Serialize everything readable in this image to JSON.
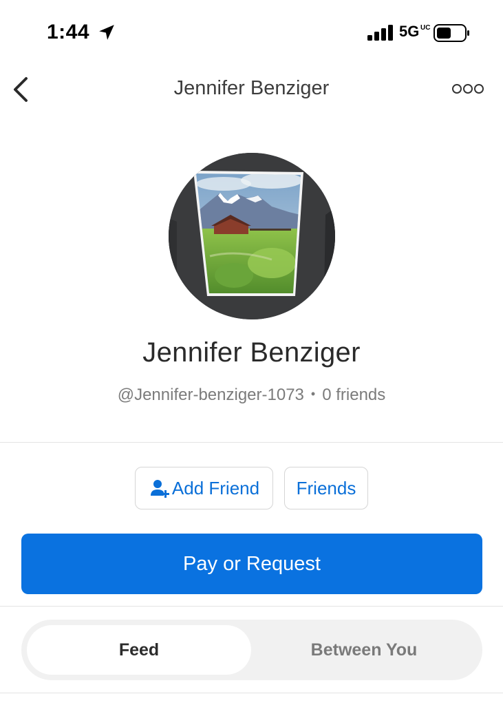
{
  "status_bar": {
    "time": "1:44",
    "network": "5G",
    "network_sub": "UC",
    "icons": [
      "location-arrow-icon",
      "cellular-signal-icon",
      "battery-icon"
    ]
  },
  "nav": {
    "title": "Jennifer Benziger",
    "icons": [
      "back-chevron-icon",
      "more-options-icon"
    ]
  },
  "profile": {
    "name": "Jennifer Benziger",
    "handle": "@Jennifer-benziger-1073",
    "separator": "•",
    "friends_count": "0 friends"
  },
  "actions": {
    "add_friend_label": "Add Friend",
    "add_friend_icon": "add-person-icon",
    "friends_label": "Friends",
    "pay_request_label": "Pay or Request"
  },
  "tabs": {
    "items": [
      {
        "label": "Feed",
        "selected": true
      },
      {
        "label": "Between You",
        "selected": false
      }
    ]
  },
  "colors": {
    "accent": "#0a72e0",
    "link": "#0a6fd8",
    "muted_text": "#7b7b7b"
  }
}
